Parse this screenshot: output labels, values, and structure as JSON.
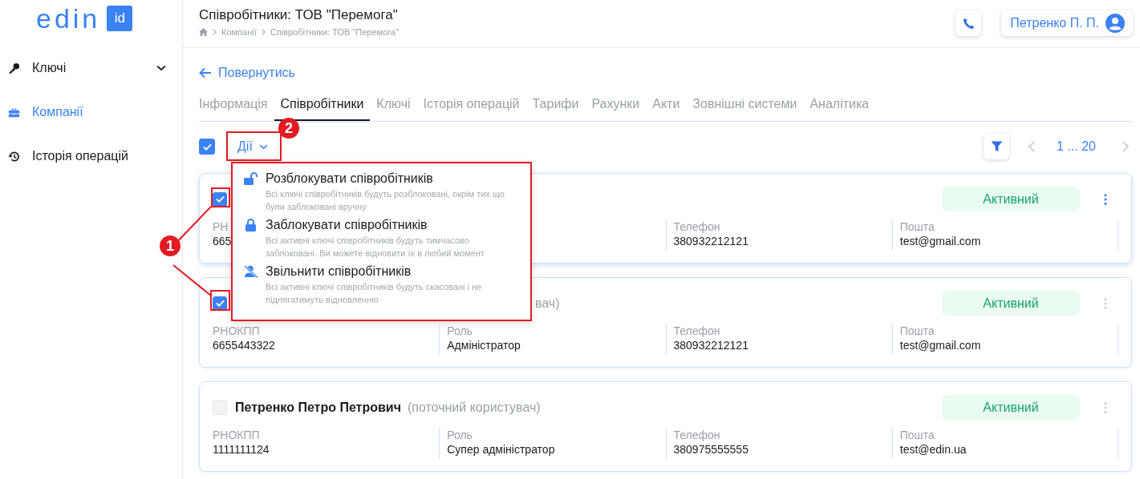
{
  "logo": {
    "text": "edin",
    "badge": "id"
  },
  "sidebar": {
    "items": [
      {
        "label": "Ключі",
        "selected": false,
        "expandable": true
      },
      {
        "label": "Компанії",
        "selected": true,
        "expandable": false
      },
      {
        "label": "Історія операцій",
        "selected": false,
        "expandable": false
      }
    ]
  },
  "header": {
    "title": "Співробітники: ТОВ \"Перемога\"",
    "breadcrumb": [
      "Компанії",
      "Співробітники: ТОВ \"Перемога\""
    ],
    "user": "Петренко П. П."
  },
  "back_link": "Повернутись",
  "tabs": [
    {
      "label": "Інформація",
      "selected": false
    },
    {
      "label": "Співробітники",
      "selected": true
    },
    {
      "label": "Ключі",
      "selected": false
    },
    {
      "label": "Історія операцій",
      "selected": false
    },
    {
      "label": "Тарифи",
      "selected": false
    },
    {
      "label": "Рахунки",
      "selected": false
    },
    {
      "label": "Акти",
      "selected": false
    },
    {
      "label": "Зовнішні системи",
      "selected": false
    },
    {
      "label": "Аналітика",
      "selected": false
    }
  ],
  "toolbar": {
    "select_all": {
      "checked": true
    },
    "actions_label": "Дії",
    "pagination": "1 ... 20"
  },
  "actions_menu": {
    "items": [
      {
        "title": "Розблокувати співробітників",
        "description": "Всі ключі співробітників будуть розблоковані, окрім тих що були заблоковані вручну"
      },
      {
        "title": "Заблокувати співробітників",
        "description": "Всі активні ключі співробітників будуть тимчасово заблоковані. Ви можете відновити їх в любий момент"
      },
      {
        "title": "Звільнити співробітників",
        "description": "Всі активні ключі співробітників будуть скасовані і не підлягатимуть відновленню"
      }
    ]
  },
  "employees": [
    {
      "selected": true,
      "highlighted": true,
      "status": "Активний",
      "fields": [
        {
          "label": "РН",
          "value": "665"
        },
        {
          "label": "Телефон",
          "value": "380932212121"
        },
        {
          "label": "Пошта",
          "value": "test@gmail.com"
        }
      ]
    },
    {
      "selected": true,
      "highlighted": false,
      "subtitle": "вач)",
      "status": "Активний",
      "fields": [
        {
          "label": "РНОКПП",
          "value": "6655443322"
        },
        {
          "label": "Роль",
          "value": "Адміністратор"
        },
        {
          "label": "Телефон",
          "value": "380932212121"
        },
        {
          "label": "Пошта",
          "value": "test@gmail.com"
        }
      ]
    },
    {
      "selected": false,
      "highlighted": false,
      "name": "Петренко Петро Петрович",
      "subtitle": "(поточний користувач)",
      "status": "Активний",
      "fields": [
        {
          "label": "РНОКПП",
          "value": "1111111124"
        },
        {
          "label": "Роль",
          "value": "Супер адміністратор"
        },
        {
          "label": "Телефон",
          "value": "380975555555"
        },
        {
          "label": "Пошта",
          "value": "test@edin.ua"
        }
      ]
    }
  ],
  "annotations": [
    {
      "label": "1"
    },
    {
      "label": "2"
    }
  ]
}
